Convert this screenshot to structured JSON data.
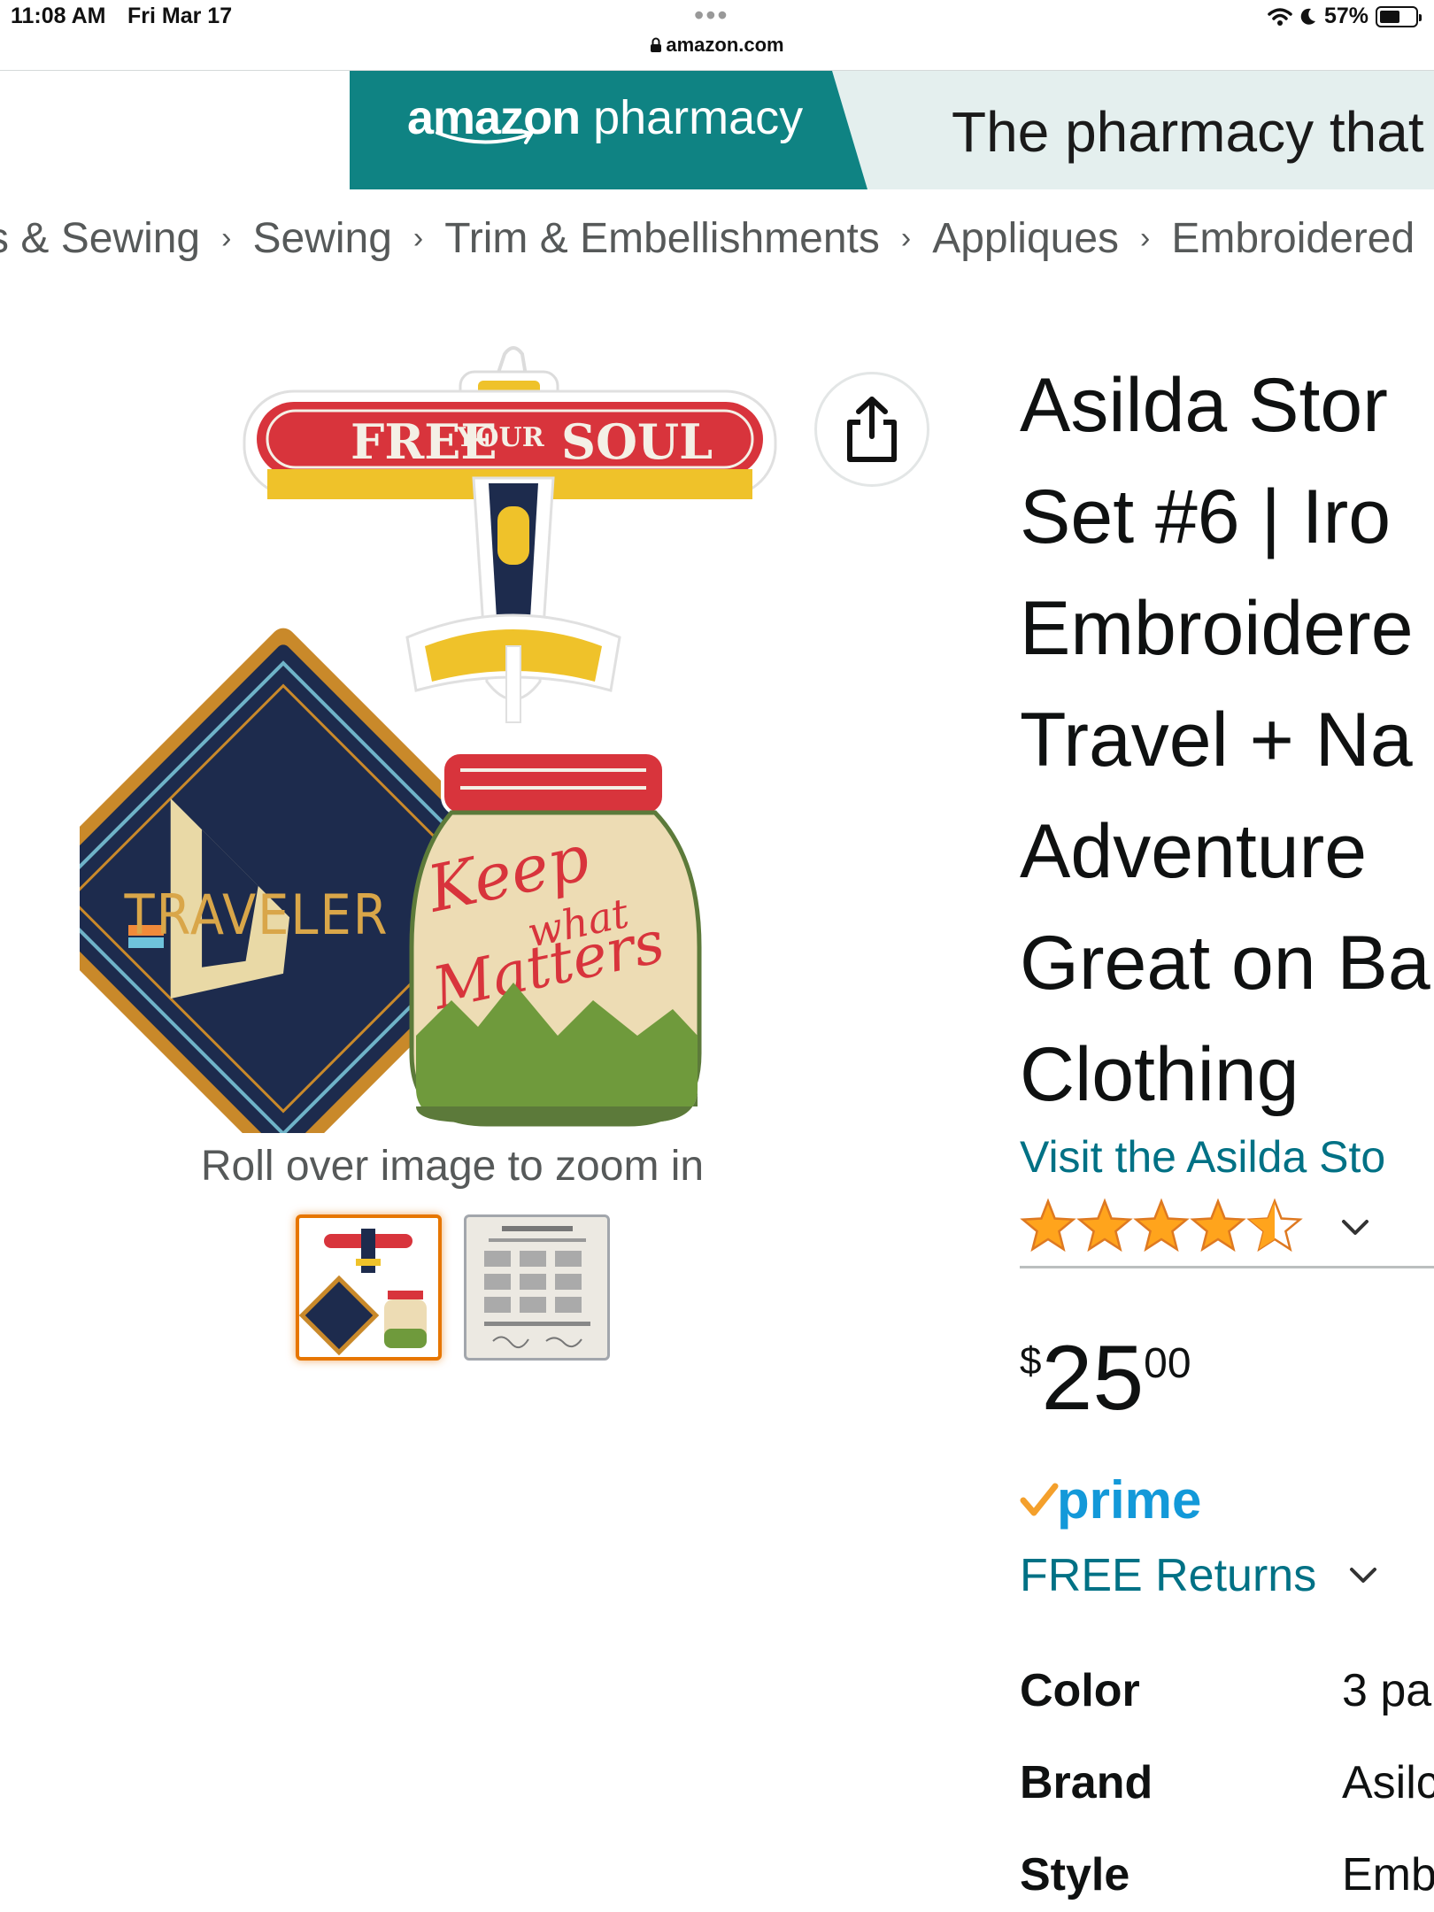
{
  "status_bar": {
    "time": "11:08 AM",
    "date": "Fri Mar 17",
    "battery": "57%",
    "battery_level": 0.57
  },
  "browser": {
    "url": "amazon.com",
    "more_dots": "•••"
  },
  "banner": {
    "logo_bold": "amazon",
    "logo_light": " pharmacy",
    "tagline": "The pharmacy that"
  },
  "breadcrumb": {
    "items": [
      "s & Sewing",
      "Sewing",
      "Trim & Embellishments",
      "Appliques",
      "Embroidered"
    ],
    "separator": "›"
  },
  "gallery": {
    "main_image": {
      "patch_airplane": {
        "text_left": "FREE",
        "text_mid": "YOUR",
        "text_right": "SOUL"
      },
      "patch_diamond": {
        "text": "TRAVELER"
      },
      "patch_jar": {
        "line1": "Keep",
        "line2": "what",
        "line3": "Matters"
      }
    },
    "zoom_hint": "Roll over image to zoom in",
    "thumbnails": [
      {
        "label": "main-thumbnail",
        "selected": true
      },
      {
        "label": "instructions-thumbnail",
        "selected": false
      }
    ]
  },
  "product": {
    "title": "Asilda Stor\nSet #6 | Iro\nEmbroidere\nTravel + Na\nAdventure \nGreat on Ba\nClothing",
    "store_link": "Visit the Asilda Sto",
    "rating": 4.5,
    "price": {
      "symbol": "$",
      "whole": "25",
      "fraction": "00"
    },
    "prime_label": "prime",
    "returns": "FREE Returns",
    "specs": [
      {
        "label": "Color",
        "value": "3 pa"
      },
      {
        "label": "Brand",
        "value": "Asilc"
      },
      {
        "label": "Style",
        "value": "Emb"
      }
    ]
  },
  "colors": {
    "link": "#007185",
    "prime": "#1399d9",
    "star": "#ffa41c",
    "banner_teal": "#0f8383"
  }
}
